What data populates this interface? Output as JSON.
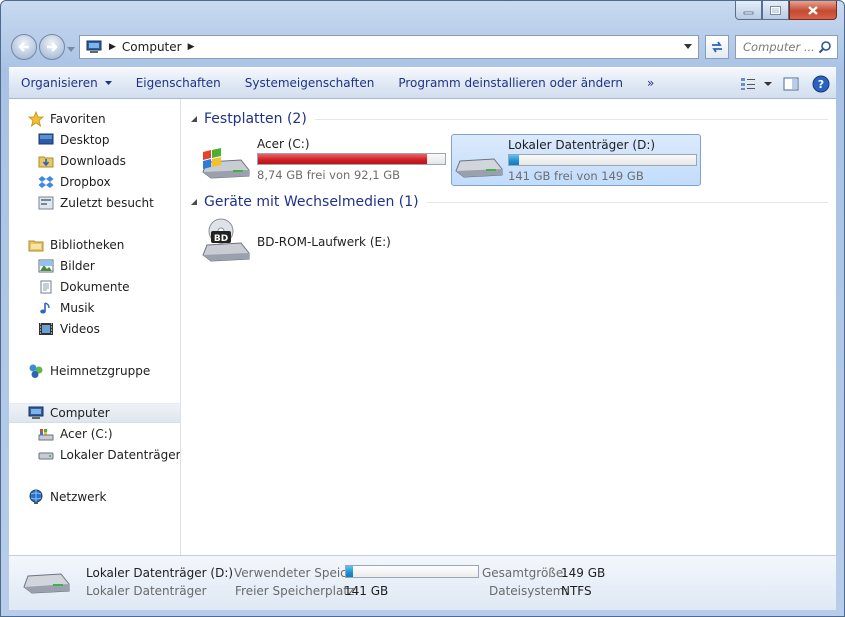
{
  "address": {
    "crumbs": [
      "Computer"
    ]
  },
  "search": {
    "placeholder": "Computer ..."
  },
  "toolbar": {
    "organize": "Organisieren",
    "properties": "Eigenschaften",
    "system_properties": "Systemeigenschaften",
    "uninstall": "Programm deinstallieren oder ändern",
    "more": "»"
  },
  "sidebar": {
    "favorites": {
      "label": "Favoriten",
      "items": [
        "Desktop",
        "Downloads",
        "Dropbox",
        "Zuletzt besucht"
      ]
    },
    "libraries": {
      "label": "Bibliotheken",
      "items": [
        "Bilder",
        "Dokumente",
        "Musik",
        "Videos"
      ]
    },
    "homegroup": "Heimnetzgruppe",
    "computer": {
      "label": "Computer",
      "items": [
        "Acer (C:)",
        "Lokaler Datenträger (D:"
      ]
    },
    "network": "Netzwerk"
  },
  "groups": {
    "hdd": {
      "title": "Festplatten (2)",
      "drives": [
        {
          "name": "Acer (C:)",
          "free": "8,74 GB frei von 92,1 GB",
          "used_fraction": 0.905,
          "bar_color": "#cf1d22"
        },
        {
          "name": "Lokaler Datenträger (D:)",
          "free": "141 GB frei von 149 GB",
          "used_fraction": 0.054,
          "bar_color": "#1f8ed0"
        }
      ]
    },
    "removable": {
      "title": "Geräte mit Wechselmedien (1)",
      "devices": [
        {
          "name": "BD-ROM-Laufwerk (E:)",
          "badge": "BD"
        }
      ]
    }
  },
  "details": {
    "name": "Lokaler Datenträger (D:)",
    "type": "Lokaler Datenträger",
    "used_label": "Verwendeter Speic...",
    "used_fraction": 0.054,
    "free_label": "Freier Speicherplatz:",
    "free_value": "141 GB",
    "total_label": "Gesamtgröße:",
    "total_value": "149 GB",
    "fs_label": "Dateisystem:",
    "fs_value": "NTFS"
  },
  "colors": {
    "accent_text": "#1e3287",
    "selection": "#c1dcfc"
  }
}
